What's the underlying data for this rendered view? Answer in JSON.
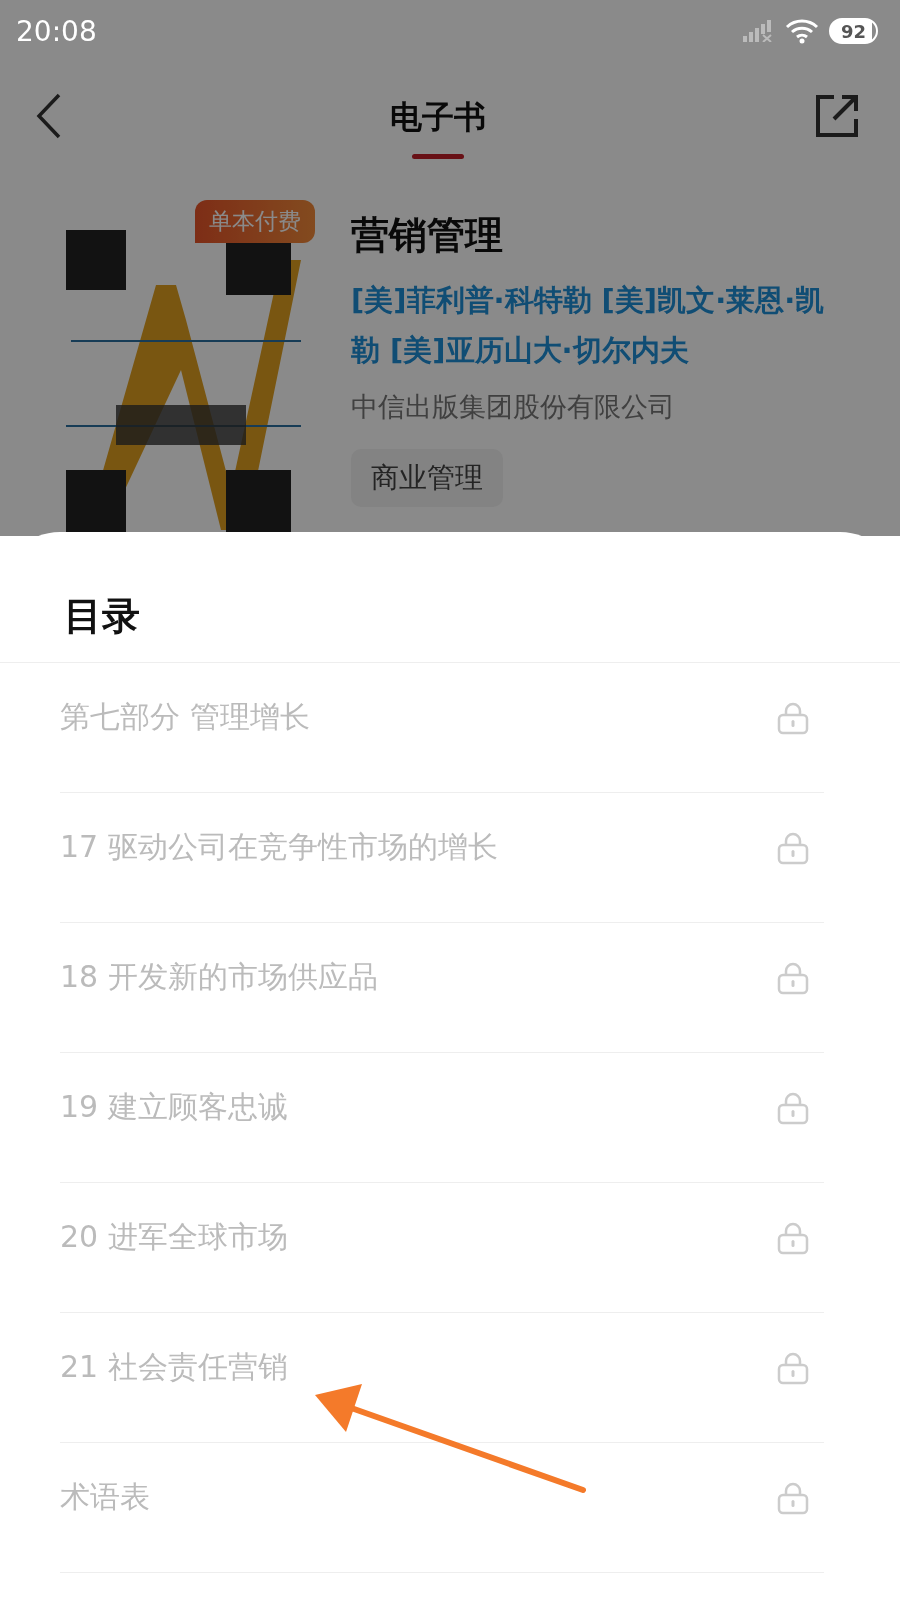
{
  "status_bar": {
    "time": "20:08",
    "battery": "92"
  },
  "header": {
    "title": "电子书"
  },
  "book": {
    "badge": "单本付费",
    "title": "营销管理",
    "authors": "[美]菲利普·科特勒 [美]凯文·莱恩·凯勒 [美]亚历山大·切尔内夫",
    "publisher": "中信出版集团股份有限公司",
    "tags": [
      "商业管理"
    ]
  },
  "contents": {
    "title": "目录",
    "items": [
      {
        "label": "第七部分 管理增长",
        "locked": true
      },
      {
        "label": "17 驱动公司在竞争性市场的增长",
        "locked": true
      },
      {
        "label": "18 开发新的市场供应品",
        "locked": true
      },
      {
        "label": "19 建立顾客忠诚",
        "locked": true
      },
      {
        "label": "20 进军全球市场",
        "locked": true
      },
      {
        "label": "21 社会责任营销",
        "locked": true
      },
      {
        "label": "术语表",
        "locked": true
      }
    ]
  }
}
